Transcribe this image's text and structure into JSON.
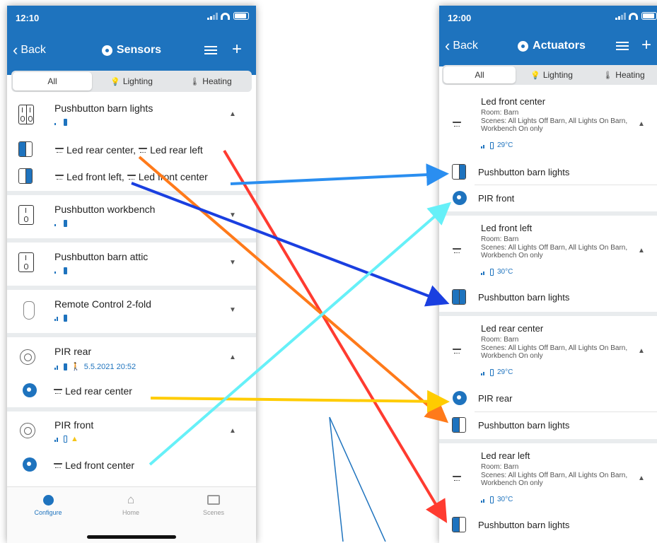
{
  "colors": {
    "brand": "#1e73be",
    "warning": "#f5c518"
  },
  "left": {
    "status_time": "12:10",
    "back_label": "Back",
    "title": "Sensors",
    "tabs": [
      "All",
      "Lighting",
      "Heating"
    ],
    "sensors": [
      {
        "name": "Pushbutton barn lights",
        "links": [
          {
            "a": "Led rear center,",
            "b": "Led rear left"
          },
          {
            "a": "Led front left,",
            "b": "Led front center"
          }
        ]
      },
      {
        "name": "Pushbutton workbench"
      },
      {
        "name": "Pushbutton barn attic"
      },
      {
        "name": "Remote Control 2-fold"
      },
      {
        "name": "PIR rear",
        "timestamp": "5.5.2021 20:52",
        "link": "Led rear center"
      },
      {
        "name": "PIR front",
        "link": "Led front center"
      }
    ],
    "bottom_tabs": [
      "Configure",
      "Home",
      "Scenes"
    ]
  },
  "right": {
    "status_time": "12:00",
    "back_label": "Back",
    "title": "Actuators",
    "tabs": [
      "All",
      "Lighting",
      "Heating"
    ],
    "actuators": [
      {
        "name": "Led front center",
        "room": "Room: Barn",
        "scenes": "Scenes: All Lights Off Barn, All Lights On Barn, Workbench On only",
        "temp": "29°C",
        "subs": [
          "Pushbutton barn lights",
          "PIR front"
        ]
      },
      {
        "name": "Led front left",
        "room": "Room: Barn",
        "scenes": "Scenes: All Lights Off Barn, All Lights On Barn, Workbench On only",
        "temp": "30°C",
        "subs": [
          "Pushbutton barn lights"
        ]
      },
      {
        "name": "Led rear center",
        "room": "Room: Barn",
        "scenes": "Scenes: All Lights Off Barn, All Lights On Barn, Workbench On only",
        "temp": "29°C",
        "subs": [
          "PIR rear",
          "Pushbutton barn lights"
        ]
      },
      {
        "name": "Led rear left",
        "room": "Room: Barn",
        "scenes": "Scenes: All Lights Off Barn, All Lights On Barn, Workbench On only",
        "temp": "30°C",
        "subs": [
          "Pushbutton barn lights"
        ]
      }
    ]
  },
  "annotation_arrow_colors": [
    "#ff3b30",
    "#ff7a1a",
    "#1a3fe0",
    "#2a8ef0",
    "#ffcc00",
    "#66f0f8",
    "#1e73be"
  ]
}
